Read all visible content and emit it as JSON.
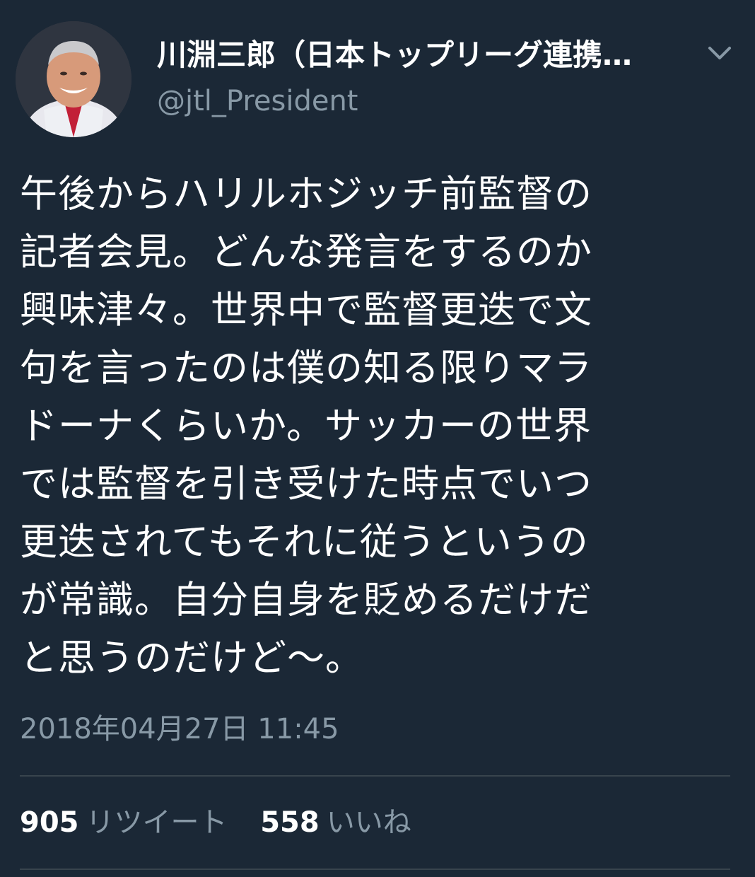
{
  "tweet": {
    "display_name": "川淵三郎（日本トップリーグ連携…",
    "handle": "@jtl_President",
    "text": "午後からハリルホジッチ前監督の\n記者会見。どんな発言をするのか\n興味津々。世界中で監督更迭で文\n句を言ったのは僕の知る限りマラ\nドーナくらいか。サッカーの世界\nでは監督を引き受けた時点でいつ\n更迭されてもそれに従うというの\nが常識。自分自身を貶めるだけだ\nと思うのだけど〜。",
    "timestamp": "2018年04月27日 11:45",
    "retweets_count": "905",
    "retweets_label": "リツイート",
    "likes_count": "558",
    "likes_label": "いいね"
  },
  "icons": {
    "menu": "chevron-down-icon",
    "avatar": "profile-photo"
  },
  "colors": {
    "background": "#1b2836",
    "primary_text": "#ffffff",
    "secondary_text": "#8899a6",
    "divider": "#38444d"
  }
}
